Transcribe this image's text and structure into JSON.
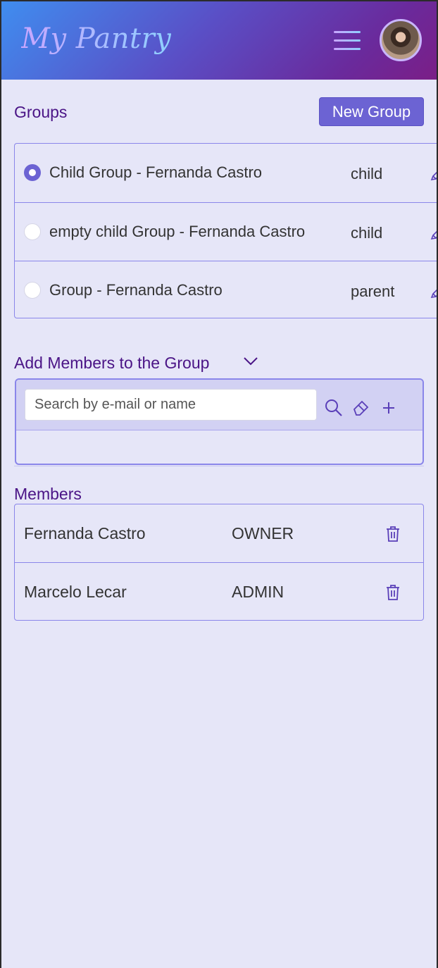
{
  "app": {
    "title": "My Pantry"
  },
  "header": {
    "menu_icon": "hamburger-menu-icon",
    "avatar_icon": "user-avatar"
  },
  "groups": {
    "title": "Groups",
    "new_button": "New Group",
    "items": [
      {
        "name": "Child Group - Fernanda Castro",
        "type": "child",
        "selected": true
      },
      {
        "name": "empty child Group - Fernanda Castro",
        "type": "child",
        "selected": false
      },
      {
        "name": "Group - Fernanda Castro",
        "type": "parent",
        "selected": false
      }
    ]
  },
  "add_members": {
    "title": "Add Members to the Group",
    "search_placeholder": "Search by e-mail or name",
    "search_value": "",
    "icons": [
      "search-icon",
      "eraser-icon",
      "plus-icon"
    ]
  },
  "members": {
    "title": "Members",
    "items": [
      {
        "name": "Fernanda Castro",
        "role": "OWNER"
      },
      {
        "name": "Marcelo Lecar",
        "role": "ADMIN"
      }
    ]
  },
  "colors": {
    "accent": "#6c63d3",
    "title_purple": "#4a1486",
    "background": "#e6e6f8",
    "border": "#8a86ea"
  }
}
